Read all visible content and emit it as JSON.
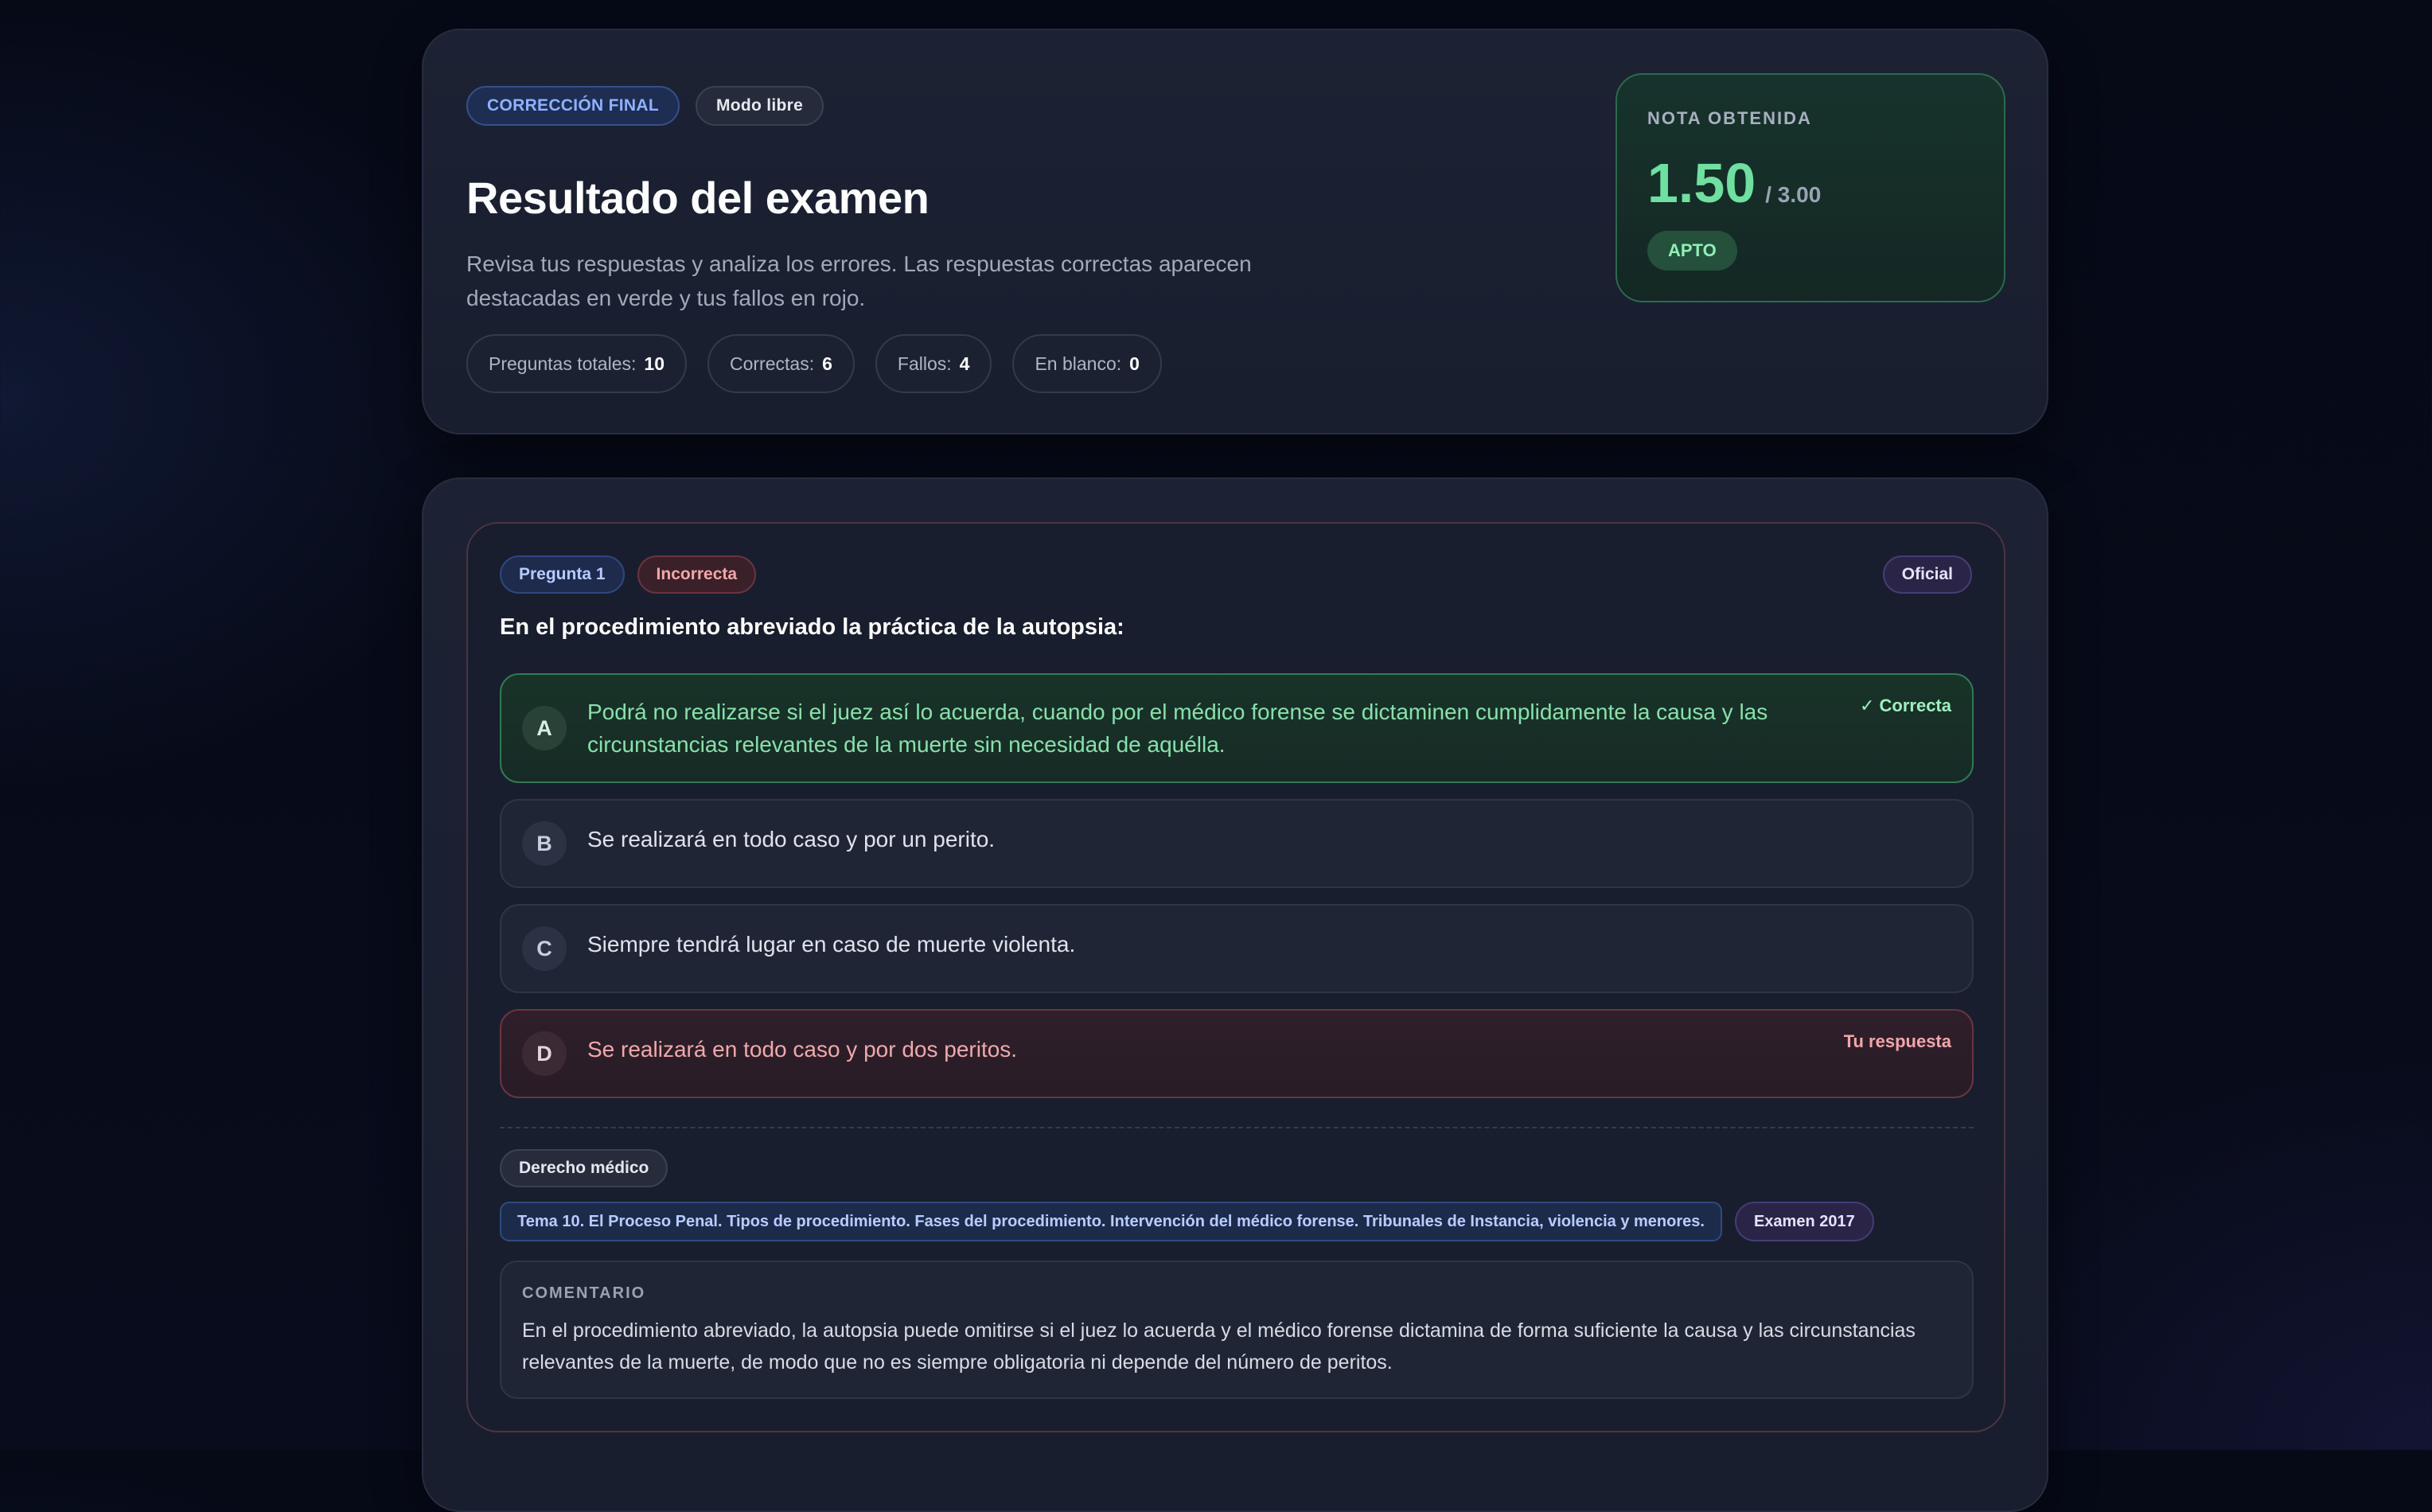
{
  "header": {
    "badge_primary": "CORRECCIÓN FINAL",
    "badge_mode": "Modo libre",
    "title": "Resultado del examen",
    "description": "Revisa tus respuestas y analiza los errores. Las respuestas correctas aparecen destacadas en verde y tus fallos en rojo.",
    "stats": [
      {
        "label": "Preguntas totales:",
        "value": "10"
      },
      {
        "label": "Correctas:",
        "value": "6"
      },
      {
        "label": "Fallos:",
        "value": "4"
      },
      {
        "label": "En blanco:",
        "value": "0"
      }
    ]
  },
  "score": {
    "label": "NOTA OBTENIDA",
    "value": "1.50",
    "max": "/ 3.00",
    "status": "APTO"
  },
  "question": {
    "number_tag": "Pregunta 1",
    "result_tag": "Incorrecta",
    "source_tag": "Oficial",
    "text": "En el procedimiento abreviado la práctica de la autopsia:",
    "options": [
      {
        "letter": "A",
        "text": "Podrá no realizarse si el juez así lo acuerda, cuando por el médico forense se dictaminen cumplidamente la causa y las circunstancias relevantes de la muerte sin necesidad de aquélla.",
        "flag": "✓ Correcta"
      },
      {
        "letter": "B",
        "text": "Se realizará en todo caso y por un perito.",
        "flag": ""
      },
      {
        "letter": "C",
        "text": "Siempre tendrá lugar en caso de muerte violenta.",
        "flag": ""
      },
      {
        "letter": "D",
        "text": "Se realizará en todo caso y por dos peritos.",
        "flag": "Tu respuesta"
      }
    ],
    "subject": "Derecho médico",
    "topic": "Tema 10. El Proceso Penal. Tipos de procedimiento. Fases del procedimiento. Intervención del médico forense. Tribunales de Instancia, violencia y menores.",
    "exam": "Examen 2017",
    "comment_label": "COMENTARIO",
    "comment": "En el procedimiento abreviado, la autopsia puede omitirse si el juez lo acuerda y el médico forense dictamina de forma suficiente la causa y las circunstancias relevantes de la muerte, de modo que no es siempre obligatoria ni depende del número de peritos."
  },
  "colors": {
    "correct": "#86e2ab",
    "wrong": "#f0a8ac",
    "accent_blue": "#8fb2ff",
    "background": "#070b19"
  }
}
